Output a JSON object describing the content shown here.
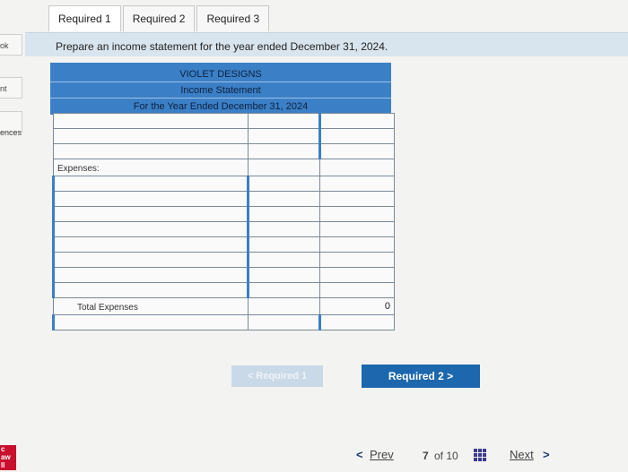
{
  "left_rail": {
    "items": [
      "ok",
      "nt",
      "ences"
    ],
    "logo_lines": [
      "c",
      "aw",
      "ll"
    ]
  },
  "tabs": [
    "Required 1",
    "Required 2",
    "Required 3"
  ],
  "instruction": "Prepare an income statement for the year ended December 31, 2024.",
  "statement": {
    "company": "VIOLET DESIGNS",
    "title": "Income Statement",
    "period": "For the Year Ended December 31, 2024",
    "expenses_label": "Expenses:",
    "total_expenses_label": "Total Expenses",
    "total_expenses_value": "0"
  },
  "nav": {
    "prev_required": "< Required 1",
    "next_required": "Required 2  >",
    "prev": "Prev",
    "prev_chevron": "<",
    "page_current": "7",
    "page_of": "of 10",
    "next": "Next",
    "next_chevron": ">"
  },
  "colors": {
    "header_blue": "#3b7fc6",
    "button_blue": "#1c67ad",
    "banner": "#d9e5ee"
  }
}
